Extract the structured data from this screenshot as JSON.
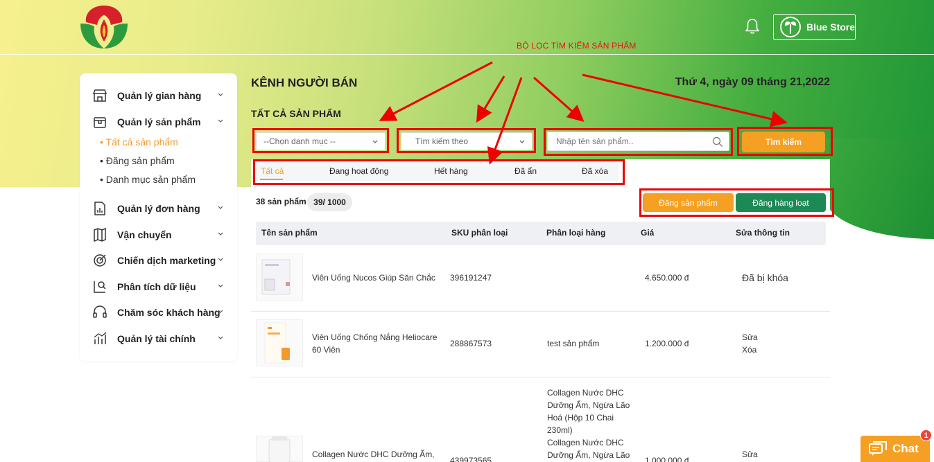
{
  "header": {
    "store_name": "Blue Store"
  },
  "annotation": {
    "label": "BỘ LỌC TÌM KIẾM SẢN PHẨM",
    "color": "#e00000"
  },
  "sidebar": {
    "items": [
      {
        "label": "Quản lý gian hàng",
        "icon": "store-icon"
      },
      {
        "label": "Quản lý sản phẩm",
        "icon": "box-icon"
      },
      {
        "label": "Quản lý đơn hàng",
        "icon": "order-chart-icon"
      },
      {
        "label": "Vận chuyển",
        "icon": "map-icon"
      },
      {
        "label": "Chiến dịch marketing",
        "icon": "target-icon"
      },
      {
        "label": "Phân tích dữ liệu",
        "icon": "analytics-icon"
      },
      {
        "label": "Chăm sóc khách hàng",
        "icon": "headset-icon"
      },
      {
        "label": "Quản lý tài chính",
        "icon": "finance-chart-icon"
      }
    ],
    "subitems": [
      {
        "label": "Tất cả sản phẩm",
        "active": true
      },
      {
        "label": "Đăng sản phẩm",
        "active": false
      },
      {
        "label": "Danh mục sản phẩm",
        "active": false
      }
    ]
  },
  "main": {
    "page_title": "KÊNH NGƯỜI BÁN",
    "date": "Thứ 4, ngày 09 tháng 21,2022",
    "section_title": "TẤT CẢ SẢN PHẨM",
    "filters": {
      "category_select": "--Chọn danh mục --",
      "search_by_select": "Tìm kiếm theo",
      "search_placeholder": "Nhập tên sản phẩm..",
      "search_button": "Tìm kiếm"
    },
    "tabs": [
      {
        "label": "Tất cả",
        "active": true
      },
      {
        "label": "Đang hoạt động",
        "active": false
      },
      {
        "label": "Hết hàng",
        "active": false
      },
      {
        "label": "Đã ẩn",
        "active": false
      },
      {
        "label": "Đã xóa",
        "active": false
      }
    ],
    "product_count": "38 sản phẩm",
    "quota": "39/ 1000",
    "post_button": "Đăng sản phẩm",
    "bulk_button": "Đăng hàng loạt",
    "table": {
      "columns": [
        "Tên sản phẩm",
        "SKU phân loại",
        "Phân loại hàng",
        "Giá",
        "Sửa thông tin"
      ],
      "rows": [
        {
          "name": "Viên Uống Nucos Giúp Săn Chắc",
          "name_line2": "",
          "sku": "396191247",
          "variant_lines": [],
          "price": "4.650.000 đ",
          "status": "Đã bị khóa",
          "edit": "",
          "delete": ""
        },
        {
          "name": "Viên Uống Chống Nắng Heliocare",
          "name_line2": "60 Viên",
          "sku": "288867573",
          "variant_lines": [
            "test sản phẩm"
          ],
          "price": "1.200.000 đ",
          "status": "",
          "edit": "Sửa",
          "delete": "Xóa"
        },
        {
          "name": "Collagen Nước DHC Dưỡng Ẩm,",
          "name_line2": "",
          "sku": "439973565",
          "variant_lines": [
            "Collagen Nước DHC",
            "Dưỡng Ẩm, Ngừa Lão",
            "Hoá (Hộp 10 Chai",
            "230ml)",
            "Collagen Nước DHC",
            "Dưỡng Ẩm, Ngừa Lão"
          ],
          "price": "1.000.000 đ",
          "status": "",
          "edit": "Sửa",
          "delete": ""
        }
      ]
    }
  },
  "chat": {
    "label": "Chat",
    "badge": "1"
  },
  "colors": {
    "accent_orange": "#f5a023",
    "accent_green": "#1d8a55",
    "brand_red": "#d6202a",
    "brand_green": "#2e9a3e"
  }
}
